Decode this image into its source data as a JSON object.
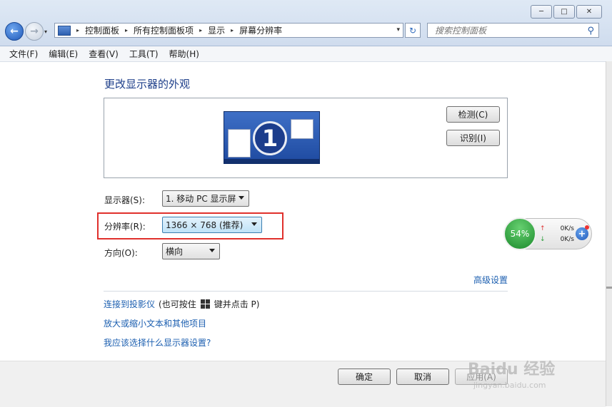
{
  "window": {
    "minimize_glyph": "─",
    "maximize_glyph": "□",
    "close_glyph": "✕"
  },
  "nav": {
    "back_glyph": "←",
    "forward_glyph": "→",
    "dropdown_glyph": "▾",
    "refresh_glyph": "↻"
  },
  "address": {
    "breadcrumbs": [
      "控制面板",
      "所有控制面板项",
      "显示",
      "屏幕分辨率"
    ],
    "crumb_arrow": "▸",
    "dropdown_glyph": "▾"
  },
  "search": {
    "placeholder": "搜索控制面板",
    "icon_glyph": "⚲"
  },
  "menu": [
    "文件(F)",
    "编辑(E)",
    "查看(V)",
    "工具(T)",
    "帮助(H)"
  ],
  "main": {
    "heading": "更改显示器的外观",
    "monitor_number": "1",
    "detect_button": "检测(C)",
    "identify_button": "识别(I)",
    "display_label": "显示器(S):",
    "display_value": "1. 移动 PC 显示屏",
    "resolution_label": "分辨率(R):",
    "resolution_value": "1366 × 768 (推荐)",
    "orientation_label": "方向(O):",
    "orientation_value": "横向",
    "advanced_link": "高级设置",
    "projector_link": "连接到投影仪",
    "projector_hint_before": "(也可按住",
    "projector_hint_after": "键并点击 P)",
    "enlarge_link": "放大或缩小文本和其他项目",
    "help_link": "我应该选择什么显示器设置?"
  },
  "gadget": {
    "percent": "54%",
    "up_arrow": "↑",
    "down_arrow": "↓",
    "up_speed": "0K/s",
    "down_speed": "0K/s",
    "plus_glyph": "+"
  },
  "buttons": {
    "ok": "确定",
    "cancel": "取消",
    "apply": "应用(A)"
  },
  "watermark": {
    "text": "Baidu 经验",
    "url": "jingyan.baidu.com"
  },
  "colors": {
    "link": "#1c5fb0",
    "heading": "#1e3f8a",
    "highlight_box": "#e0302c"
  }
}
